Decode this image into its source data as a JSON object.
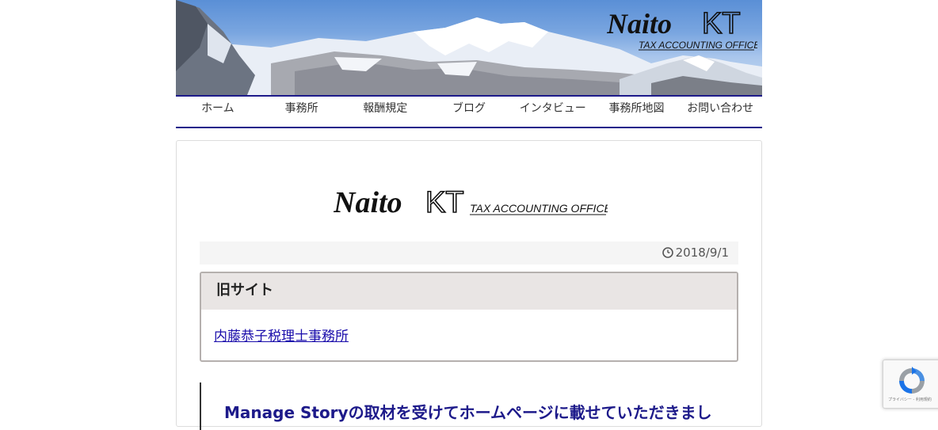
{
  "header": {
    "logo_main": "Naito",
    "logo_kt": "KT",
    "logo_sub": "TAX ACCOUNTING OFFICE"
  },
  "nav": {
    "items": [
      {
        "label": "ホーム"
      },
      {
        "label": "事務所"
      },
      {
        "label": "報酬規定"
      },
      {
        "label": "ブログ"
      },
      {
        "label": "インタビュー"
      },
      {
        "label": "事務所地図"
      },
      {
        "label": "お問い合わせ"
      }
    ]
  },
  "post": {
    "date": "2018/9/1",
    "old_site": {
      "heading": "旧サイト",
      "link_text": "内藤恭子税理士事務所"
    },
    "next_title": "Manage Storyの取材を受けてホームページに載せていただきまし"
  },
  "recaptcha": {
    "footer": "プライバシー - 利用規約"
  },
  "colors": {
    "nav_border": "#1d1a8a",
    "title": "#1d1a8a",
    "link": "#1a0dab",
    "box_head": "#e9e5e4"
  }
}
